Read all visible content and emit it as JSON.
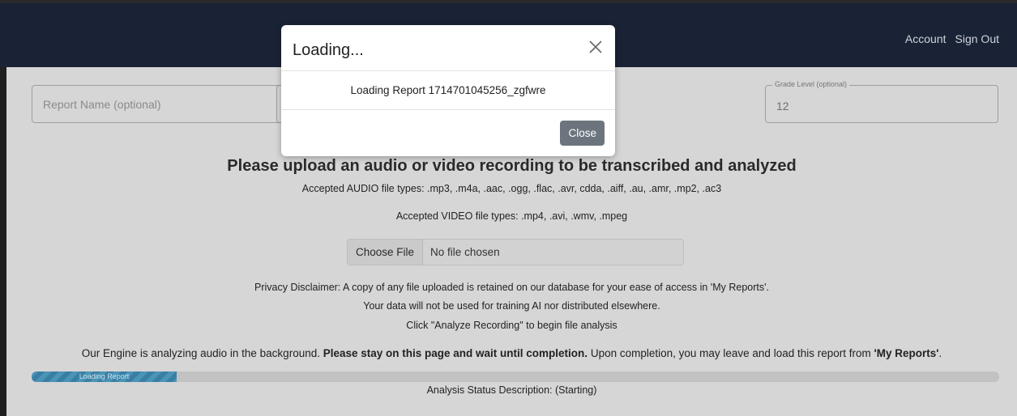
{
  "nav": {
    "account": "Account",
    "signout": "Sign Out"
  },
  "form": {
    "report_name_placeholder": "Report Name (optional)",
    "grade_level_legend": "Grade Level (optional)",
    "grade_level_value": "12"
  },
  "upload": {
    "heading": "Please upload an audio or video recording to be transcribed and analyzed",
    "audio_types": "Accepted AUDIO file types: .mp3, .m4a, .aac, .ogg, .flac, .avr, cdda, .aiff, .au, .amr, .mp2, .ac3",
    "video_types": "Accepted VIDEO file types: .mp4, .avi, .wmv, .mpeg",
    "choose_file": "Choose File",
    "no_file": "No file chosen"
  },
  "privacy": {
    "line1": "Privacy Disclaimer: A copy of any file uploaded is retained on our database for your ease of access in 'My Reports'.",
    "line2": "Your data will not be used for training AI nor distributed elsewhere.",
    "line3": "Click \"Analyze Recording\" to begin file analysis"
  },
  "engine": {
    "part1": "Our Engine is analyzing audio in the background. ",
    "part2": "Please stay on this page and wait until completion.",
    "part3": " Upon completion, you may leave and load this report from ",
    "part4": "'My Reports'",
    "part5": "."
  },
  "progress": {
    "label": "Loading Report",
    "value": 0.15
  },
  "status": "Analysis Status Description: (Starting)",
  "modal": {
    "title": "Loading...",
    "body": "Loading Report 1714701045256_zgfwre",
    "close": "Close"
  }
}
